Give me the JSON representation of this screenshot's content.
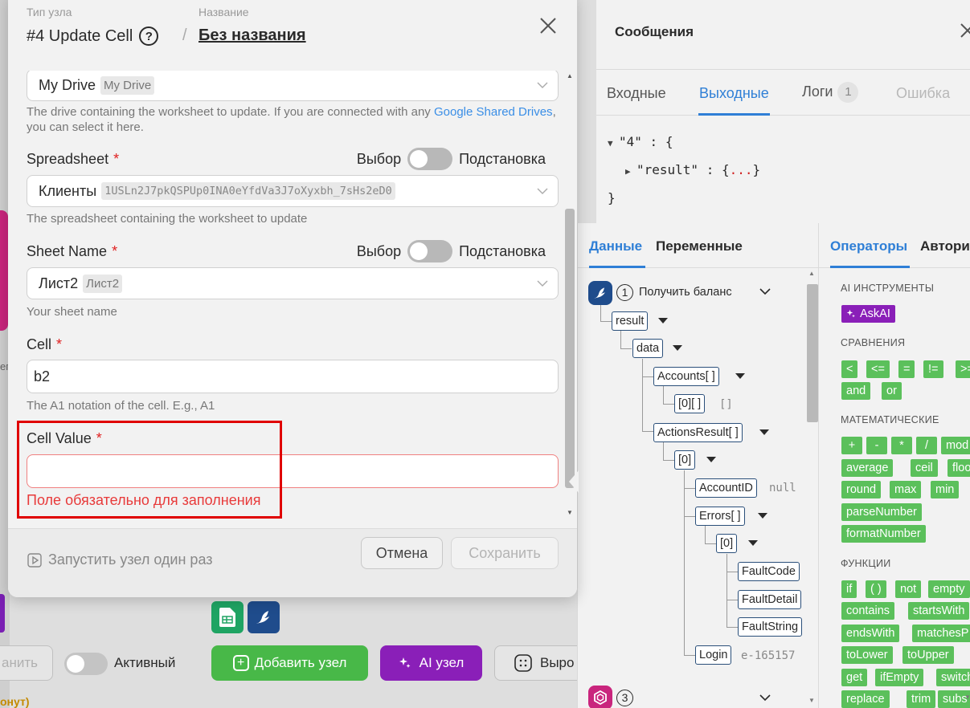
{
  "background": {
    "side_text": "ег",
    "keep_button": "анить",
    "active_label": "Активный",
    "add_node": "Добавить узел",
    "ai_node": "AI узел",
    "export_button": "Выро",
    "orange_text": "онут)"
  },
  "modal": {
    "type_label": "Тип узла",
    "name_label": "Название",
    "node_title": "#4 Update Cell",
    "separator": "/",
    "node_name": "Без названия",
    "drive": {
      "value": "My Drive",
      "tag": "My Drive",
      "help_prefix": "The drive containing the worksheet to update. If you are connected with any ",
      "help_link": "Google Shared Drives",
      "help_suffix": ", you can select it here."
    },
    "spreadsheet": {
      "label": "Spreadsheet",
      "required_mark": "*",
      "toggle_left": "Выбор",
      "toggle_right": "Подстановка",
      "value": "Клиенты",
      "tag": "1USLn2J7pkQSPUp0INA0eYfdVa3J7oXyxbh_7sHs2eD0",
      "help": "The spreadsheet containing the worksheet to update"
    },
    "sheet": {
      "label": "Sheet Name",
      "required_mark": "*",
      "toggle_left": "Выбор",
      "toggle_right": "Подстановка",
      "value": "Лист2",
      "tag": "Лист2",
      "help": "Your sheet name"
    },
    "cell": {
      "label": "Cell",
      "required_mark": "*",
      "value": "b2",
      "help": "The A1 notation of the cell. E.g., A1"
    },
    "cell_value": {
      "label": "Cell Value",
      "required_mark": "*",
      "value": "",
      "error": "Поле обязательно для заполнения"
    },
    "footer": {
      "run_once": "Запустить узел один раз",
      "cancel": "Отмена",
      "save": "Сохранить"
    }
  },
  "messages": {
    "title": "Сообщения",
    "tabs": [
      {
        "label": "Входные"
      },
      {
        "label": "Выходные"
      },
      {
        "label": "Логи",
        "badge": "1"
      },
      {
        "label": "Ошибка"
      }
    ],
    "json": {
      "key1": "\"4\"",
      "colon": ":",
      "open": "{",
      "key2": "\"result\"",
      "collapsed_open": "{",
      "collapsed_dots": "...",
      "collapsed_close": "}",
      "close": "}"
    }
  },
  "data_panel": {
    "tabs": [
      "Данные",
      "Переменные"
    ],
    "tree": {
      "node1_num": "1",
      "node1_label": "Получить баланс",
      "result": "result",
      "data": "data",
      "accounts": "Accounts[ ]",
      "acc0": "[0][ ]",
      "acc0_val": "[]",
      "actions": "ActionsResult[ ]",
      "act0": "[0]",
      "accountid": "AccountID",
      "accountid_val": "null",
      "errors": "Errors[ ]",
      "err0": "[0]",
      "faultcode": "FaultCode",
      "faultdetail": "FaultDetail",
      "faultstring": "FaultString",
      "login": "Login",
      "login_val": "e-165157",
      "node3_num": "3"
    }
  },
  "operators_panel": {
    "tabs": [
      "Операторы",
      "Автори"
    ],
    "categories": {
      "ai": "AI ИНСТРУМЕНТЫ",
      "compare": "СРАВНЕНИЯ",
      "math": "МАТЕМАТИЧЕСКИЕ",
      "functions": "ФУНКЦИИ"
    },
    "ai_buttons": [
      "AskAI"
    ],
    "compare_buttons": [
      "<",
      "<=",
      "=",
      "!=",
      ">=",
      "and",
      "or"
    ],
    "math_buttons": [
      "+",
      "-",
      "*",
      "/",
      "mod",
      "average",
      "ceil",
      "floor",
      "round",
      "max",
      "min",
      "parseNumber",
      "formatNumber"
    ],
    "function_buttons": [
      "if",
      "( )",
      "not",
      "empty",
      "contains",
      "startsWith",
      "endsWith",
      "matchesP",
      "toLower",
      "toUpper",
      "get",
      "ifEmpty",
      "switch",
      "replace",
      "trim",
      "subs"
    ]
  },
  "colors": {
    "accent": "#2f7fd6",
    "success": "#48b848",
    "ai": "#8a1fb8",
    "error": "#e02020"
  }
}
